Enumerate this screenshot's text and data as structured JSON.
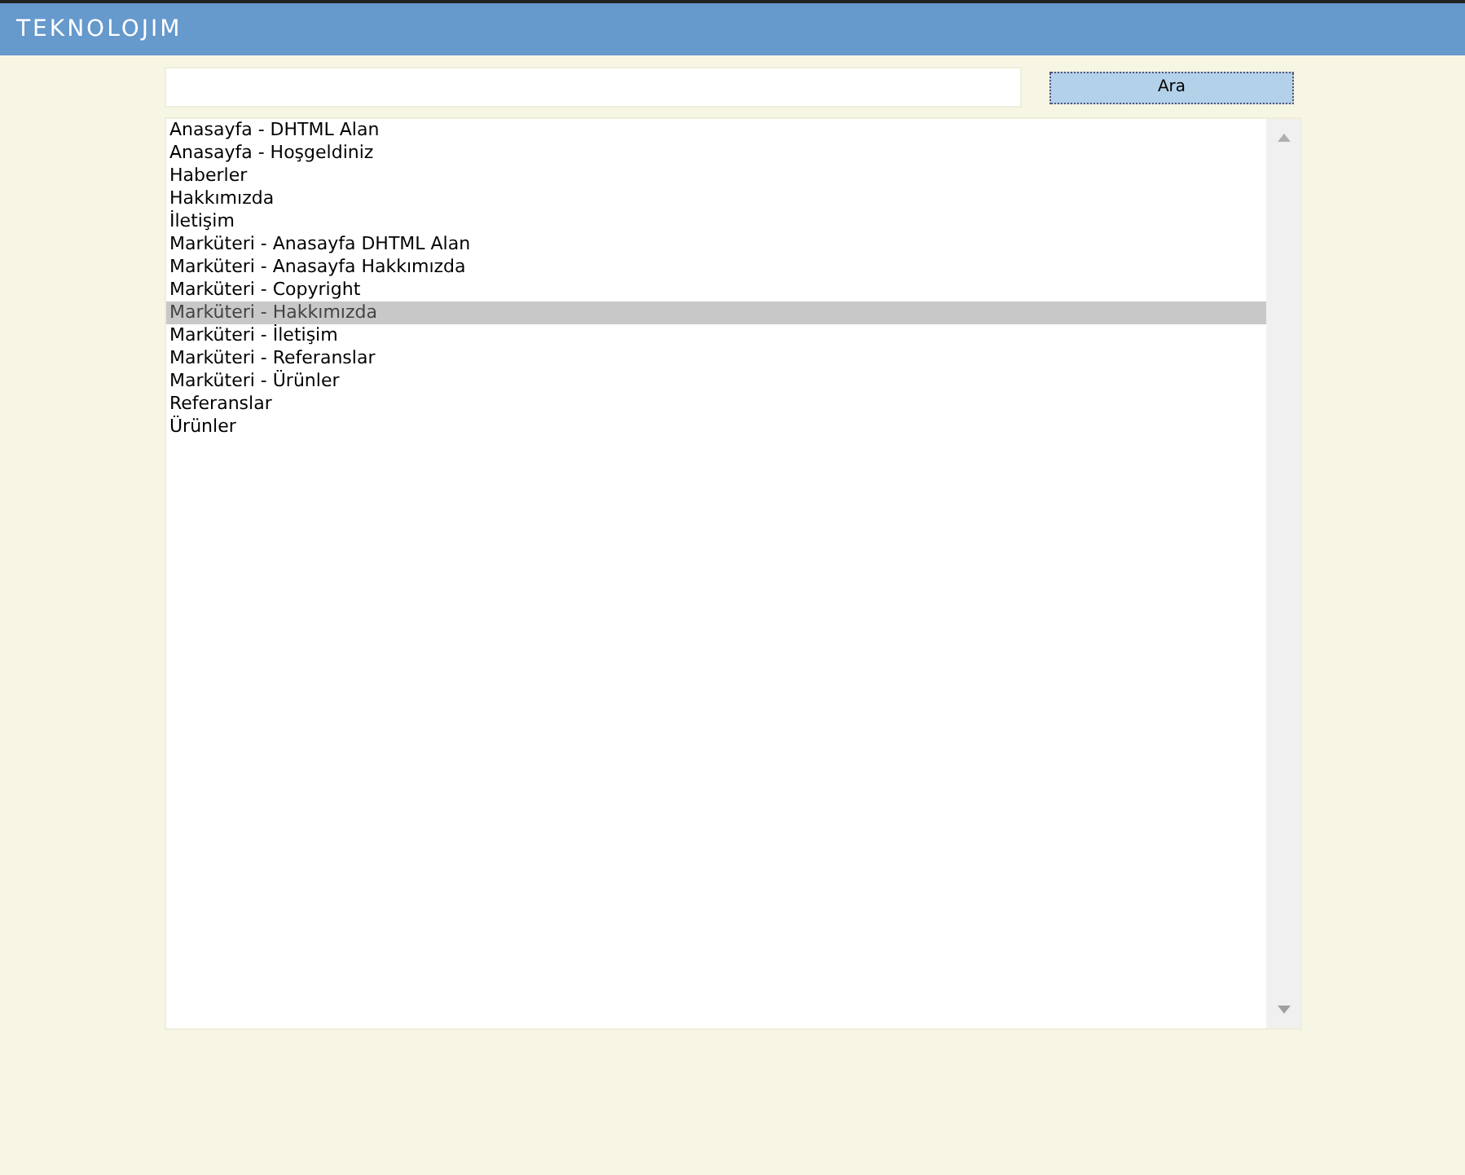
{
  "header": {
    "logo": "TEKNOLOJIM"
  },
  "search": {
    "button": "Ara"
  },
  "list": {
    "items": [
      {
        "label": "Anasayfa - DHTML Alan",
        "selected": false
      },
      {
        "label": "Anasayfa - Hoşgeldiniz",
        "selected": false
      },
      {
        "label": "Haberler",
        "selected": false
      },
      {
        "label": "Hakkımızda",
        "selected": false
      },
      {
        "label": "İletişim",
        "selected": false
      },
      {
        "label": "Marküteri - Anasayfa DHTML Alan",
        "selected": false
      },
      {
        "label": "Marküteri - Anasayfa Hakkımızda",
        "selected": false
      },
      {
        "label": "Marküteri - Copyright",
        "selected": false
      },
      {
        "label": "Marküteri - Hakkımızda",
        "selected": true
      },
      {
        "label": "Marküteri - İletişim",
        "selected": false
      },
      {
        "label": "Marküteri - Referanslar",
        "selected": false
      },
      {
        "label": "Marküteri - Ürünler",
        "selected": false
      },
      {
        "label": "Referanslar",
        "selected": false
      },
      {
        "label": "Ürünler",
        "selected": false
      }
    ]
  }
}
